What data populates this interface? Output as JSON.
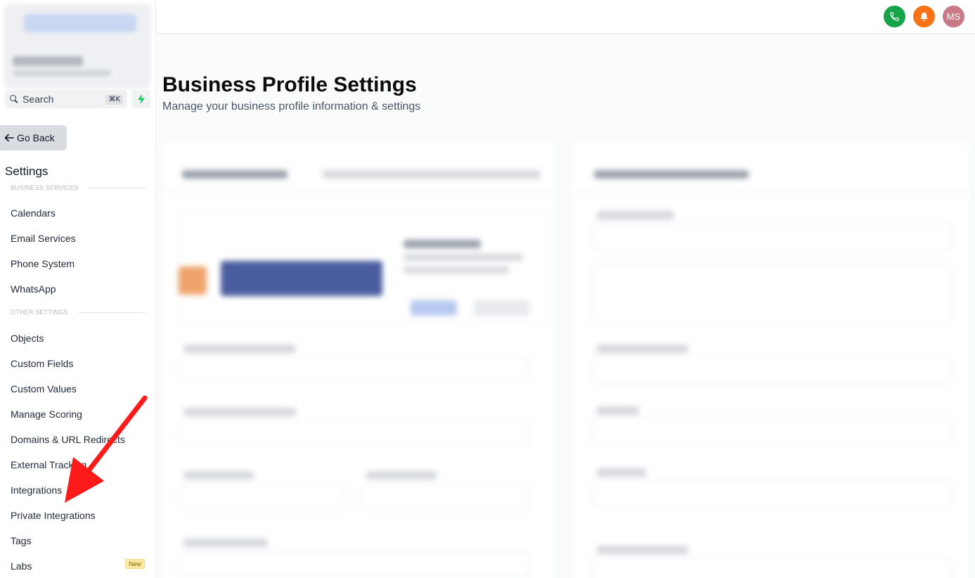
{
  "sidebar": {
    "search": {
      "label": "Search",
      "shortcut": "⌘K"
    },
    "go_back": "Go Back",
    "title": "Settings",
    "sections": [
      {
        "header": "BUSINESS SERVICES"
      },
      {
        "header": "OTHER SETTINGS"
      }
    ],
    "items": [
      "Calendars",
      "Email Services",
      "Phone System",
      "WhatsApp",
      "Objects",
      "Custom Fields",
      "Custom Values",
      "Manage Scoring",
      "Domains & URL Redirects",
      "External Tracking",
      "Integrations",
      "Private Integrations",
      "Tags",
      "Labs"
    ],
    "labs_badge": "New"
  },
  "header": {
    "avatar_initials": "MS",
    "phone_icon": "phone-icon",
    "bell_icon": "bell-icon",
    "colors": {
      "phone": "#16a34a",
      "bell": "#f97316",
      "avatar": "#c97a86"
    }
  },
  "main": {
    "title": "Business Profile Settings",
    "subtitle": "Manage your business profile information & settings"
  },
  "annotation": {
    "arrow_color": "#ff1a1a"
  }
}
